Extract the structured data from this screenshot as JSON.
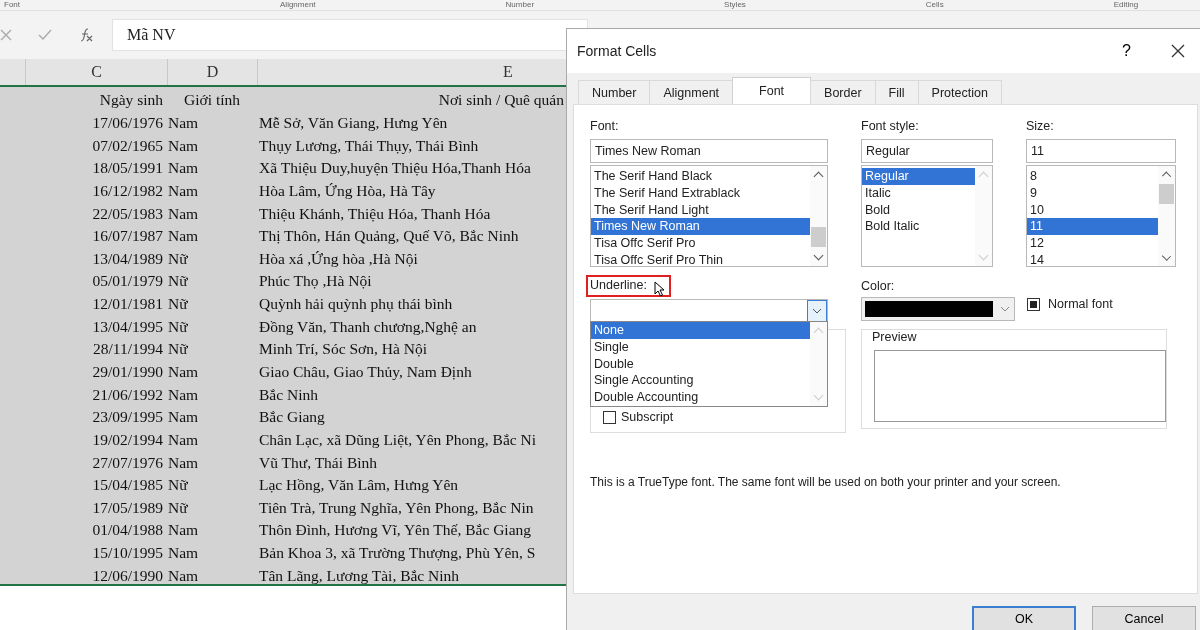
{
  "ribbon_groups": [
    "Font",
    "Alignment",
    "Number",
    "Styles",
    "Cells",
    "Editing"
  ],
  "formula_bar": {
    "value": "Mã NV"
  },
  "sheet": {
    "columns": [
      "C",
      "D",
      "E"
    ],
    "header": [
      "Ngày sinh",
      "Giới tính",
      "Nơi sinh / Quê quán"
    ],
    "rows": [
      [
        "17/06/1976",
        "Nam",
        "Mễ Sở, Văn Giang, Hưng Yên"
      ],
      [
        "07/02/1965",
        "Nam",
        "Thụy Lương, Thái Thụy, Thái Bình"
      ],
      [
        "18/05/1991",
        "Nam",
        "Xã Thiệu Duy,huyện Thiệu Hóa,Thanh Hóa"
      ],
      [
        "16/12/1982",
        "Nam",
        "Hòa Lâm, Ứng Hòa, Hà Tây"
      ],
      [
        "22/05/1983",
        "Nam",
        "Thiệu Khánh, Thiệu Hóa, Thanh Hóa"
      ],
      [
        "16/07/1987",
        "Nam",
        "Thị Thôn, Hán Quảng, Quế Võ, Bắc Ninh"
      ],
      [
        "13/04/1989",
        "Nữ",
        "Hòa xá ,Ứng hòa ,Hà Nội"
      ],
      [
        "05/01/1979",
        "Nữ",
        "Phúc Thọ ,Hà Nội"
      ],
      [
        "12/01/1981",
        "Nữ",
        "Quỳnh hải quỳnh phụ thái bình"
      ],
      [
        "13/04/1995",
        "Nữ",
        "Đồng Văn, Thanh chương,Nghệ an"
      ],
      [
        "28/11/1994",
        "Nữ",
        "Minh Trí, Sóc Sơn, Hà Nội"
      ],
      [
        "29/01/1990",
        "Nam",
        "Giao Châu, Giao Thủy, Nam Định"
      ],
      [
        "21/06/1992",
        "Nam",
        "Bắc Ninh"
      ],
      [
        "23/09/1995",
        "Nam",
        "Bắc Giang"
      ],
      [
        "19/02/1994",
        "Nam",
        "Chân Lạc, xã Dũng Liệt, Yên Phong, Bắc Ni"
      ],
      [
        "27/07/1976",
        "Nam",
        "Vũ Thư, Thái Bình"
      ],
      [
        "15/04/1985",
        "Nữ",
        "Lạc Hồng, Văn Lâm, Hưng Yên"
      ],
      [
        "17/05/1989",
        "Nữ",
        "Tiên Trà, Trung Nghĩa, Yên Phong, Bắc Nin"
      ],
      [
        "01/04/1988",
        "Nam",
        "Thôn Đình, Hương Vĩ, Yên Thế, Bắc Giang"
      ],
      [
        "15/10/1995",
        "Nam",
        "Bản Khoa 3, xã Trường Thượng, Phù Yên, S"
      ],
      [
        "12/06/1990",
        "Nam",
        "Tân Lãng, Lương Tài, Bắc Ninh"
      ]
    ]
  },
  "dialog": {
    "title": "Format Cells",
    "help": "?",
    "tabs": [
      {
        "label": "Number",
        "selected": false
      },
      {
        "label": "Alignment",
        "selected": false
      },
      {
        "label": "Font",
        "selected": true
      },
      {
        "label": "Border",
        "selected": false
      },
      {
        "label": "Fill",
        "selected": false
      },
      {
        "label": "Protection",
        "selected": false
      }
    ],
    "font": {
      "label": "Font:",
      "value": "Times New Roman",
      "options": [
        {
          "label": "The Serif Hand Black",
          "selected": false
        },
        {
          "label": "The Serif Hand Extrablack",
          "selected": false
        },
        {
          "label": "The Serif Hand Light",
          "selected": false
        },
        {
          "label": "Times New Roman",
          "selected": true
        },
        {
          "label": "Tisa Offc Serif Pro",
          "selected": false
        },
        {
          "label": "Tisa Offc Serif Pro Thin",
          "selected": false
        }
      ]
    },
    "font_style": {
      "label": "Font style:",
      "value": "Regular",
      "options": [
        {
          "label": "Regular",
          "selected": true
        },
        {
          "label": "Italic",
          "selected": false
        },
        {
          "label": "Bold",
          "selected": false
        },
        {
          "label": "Bold Italic",
          "selected": false
        }
      ]
    },
    "size": {
      "label": "Size:",
      "value": "11",
      "options": [
        {
          "label": "8",
          "selected": false
        },
        {
          "label": "9",
          "selected": false
        },
        {
          "label": "10",
          "selected": false
        },
        {
          "label": "11",
          "selected": true
        },
        {
          "label": "12",
          "selected": false
        },
        {
          "label": "14",
          "selected": false
        }
      ]
    },
    "underline": {
      "label": "Underline:",
      "highlighted": true,
      "expanded": true,
      "options": [
        {
          "label": "None",
          "selected": true
        },
        {
          "label": "Single",
          "selected": false
        },
        {
          "label": "Double",
          "selected": false
        },
        {
          "label": "Single Accounting",
          "selected": false
        },
        {
          "label": "Double Accounting",
          "selected": false
        }
      ]
    },
    "effects": [
      {
        "label": "Subscript",
        "checked": false
      }
    ],
    "color": {
      "label": "Color:",
      "color": "#000000"
    },
    "normal_font": {
      "label": "Normal font",
      "checked": true
    },
    "preview": {
      "label": "Preview"
    },
    "info": "This is a TrueType font.  The same font will be used on both your printer and your screen.",
    "buttons": [
      {
        "label": "OK",
        "default": true
      },
      {
        "label": "Cancel",
        "default": false
      }
    ]
  }
}
